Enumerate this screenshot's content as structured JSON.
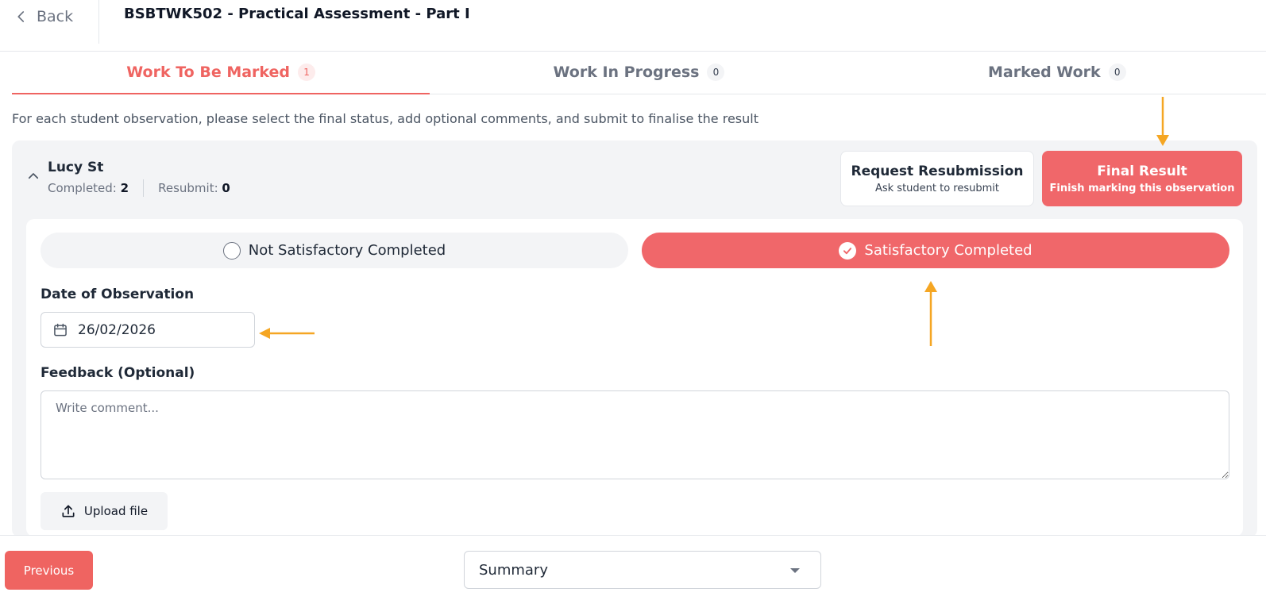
{
  "header": {
    "back_label": "Back",
    "title": "BSBTWK502 - Practical Assessment - Part I"
  },
  "tabs": [
    {
      "label": "Work To Be Marked",
      "count": "1",
      "active": true
    },
    {
      "label": "Work In Progress",
      "count": "0",
      "active": false
    },
    {
      "label": "Marked Work",
      "count": "0",
      "active": false
    }
  ],
  "instructions": "For each student observation, please select the final status, add optional comments, and submit to finalise the result",
  "observation": {
    "student_name": "Lucy St",
    "completed_label": "Completed:",
    "completed_count": "2",
    "resubmit_label": "Resubmit:",
    "resubmit_count": "0",
    "request_resubmission": {
      "title": "Request Resubmission",
      "subtitle": "Ask student to resubmit"
    },
    "final_result": {
      "title": "Final Result",
      "subtitle": "Finish marking this observation"
    },
    "options": {
      "not_satisfactory": "Not Satisfactory Completed",
      "satisfactory": "Satisfactory Completed",
      "selected": "satisfactory"
    },
    "date_label": "Date of Observation",
    "date_value": "26/02/2026",
    "feedback_label": "Feedback (Optional)",
    "feedback_placeholder": "Write comment...",
    "upload_label": "Upload file"
  },
  "footer": {
    "previous_label": "Previous",
    "select_value": "Summary"
  },
  "colors": {
    "accent": "#ef6461",
    "annotation_arrow": "#f5a623"
  }
}
